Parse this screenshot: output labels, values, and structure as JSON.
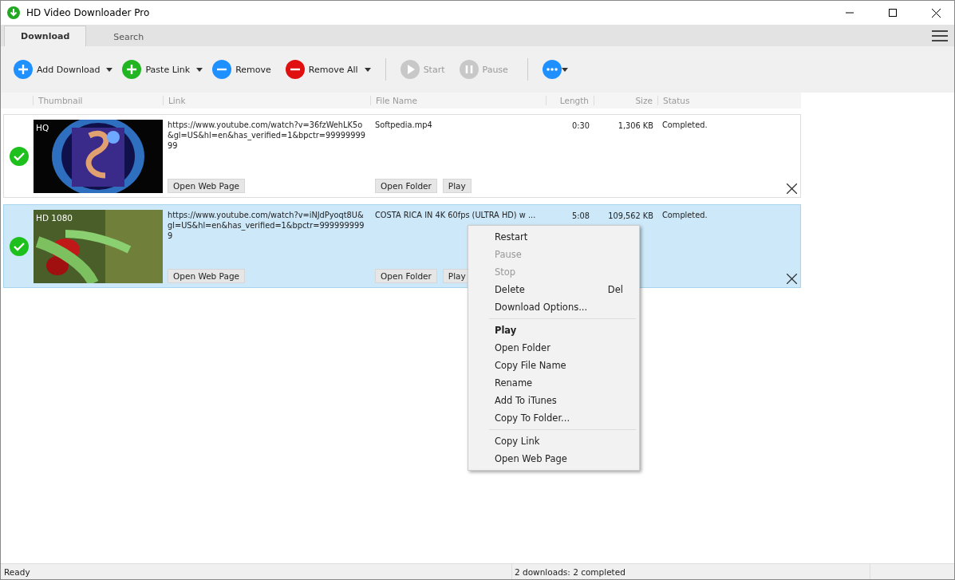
{
  "window": {
    "title": "HD Video Downloader Pro"
  },
  "tabs": [
    {
      "label": "Download",
      "selected": true
    },
    {
      "label": "Search",
      "selected": false
    }
  ],
  "toolbar": [
    {
      "kind": "add",
      "label": "Add Download",
      "disabled": false,
      "dropdown": true
    },
    {
      "kind": "paste",
      "label": "Paste Link",
      "disabled": false,
      "dropdown": true
    },
    {
      "kind": "remove",
      "label": "Remove",
      "disabled": false,
      "dropdown": false
    },
    {
      "kind": "remove-all",
      "label": "Remove All",
      "disabled": false,
      "dropdown": true
    },
    {
      "kind": "separator"
    },
    {
      "kind": "start",
      "label": "Start",
      "disabled": true,
      "dropdown": false
    },
    {
      "kind": "pause",
      "label": "Pause",
      "disabled": true,
      "dropdown": false
    },
    {
      "kind": "separator"
    },
    {
      "kind": "more",
      "disabled": false,
      "dropdown": true
    }
  ],
  "table": {
    "columns": [
      "Thumbnail",
      "Link",
      "File Name",
      "Length",
      "Size",
      "Status"
    ],
    "rows": [
      {
        "selected": false,
        "completed": true,
        "quality": "HQ",
        "link": "https://www.youtube.com/watch?v=36fzWehLK5o&gl=US&hl=en&has_verified=1&bpctr=9999999999",
        "file_name": "Softpedia.mp4",
        "length": "0:30",
        "size": "1,306 KB",
        "status": "Completed.",
        "buttons": [
          "Open Web Page",
          "Open Folder",
          "Play"
        ]
      },
      {
        "selected": true,
        "completed": true,
        "quality": "HD 1080",
        "link": "https://www.youtube.com/watch?v=iNJdPyoqt8U&gl=US&hl=en&has_verified=1&bpctr=9999999999",
        "file_name": "COSTA RICA IN 4K 60fps (ULTRA HD) w ...",
        "length": "5:08",
        "size": "109,562 KB",
        "status": "Completed.",
        "buttons": [
          "Open Web Page",
          "Open Folder",
          "Play"
        ]
      }
    ]
  },
  "context_menu": {
    "groups": [
      [
        {
          "label": "Restart",
          "disabled": false,
          "bold": false
        },
        {
          "label": "Pause",
          "disabled": true,
          "bold": false
        },
        {
          "label": "Stop",
          "disabled": true,
          "bold": false
        },
        {
          "label": "Delete",
          "disabled": false,
          "bold": false,
          "shortcut": "Del"
        },
        {
          "label": "Download Options...",
          "disabled": false,
          "bold": false
        }
      ],
      [
        {
          "label": "Play",
          "disabled": false,
          "bold": true
        },
        {
          "label": "Open Folder",
          "disabled": false,
          "bold": false
        },
        {
          "label": "Copy File Name",
          "disabled": false,
          "bold": false
        },
        {
          "label": "Rename",
          "disabled": false,
          "bold": false
        },
        {
          "label": "Add To iTunes",
          "disabled": false,
          "bold": false
        },
        {
          "label": "Copy To Folder...",
          "disabled": false,
          "bold": false
        }
      ],
      [
        {
          "label": "Copy Link",
          "disabled": false,
          "bold": false
        },
        {
          "label": "Open Web Page",
          "disabled": false,
          "bold": false
        }
      ]
    ]
  },
  "status_bar": {
    "left": "Ready",
    "right": "2 downloads: 2 completed"
  }
}
